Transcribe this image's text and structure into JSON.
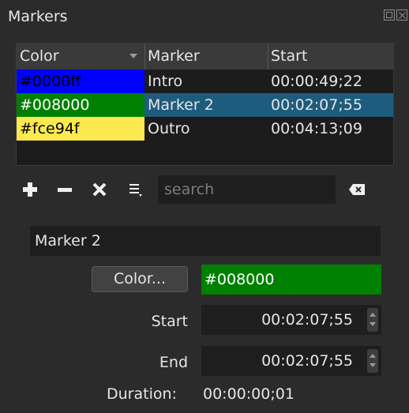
{
  "panel": {
    "title": "Markers",
    "float_icon": "float-window-icon",
    "close_icon": "close-window-icon"
  },
  "table": {
    "columns": [
      "Color",
      "Marker",
      "Start"
    ],
    "sort_column": "Color",
    "rows": [
      {
        "color": "#0000ff",
        "color_text": "#0000ff",
        "text_color": "#000000",
        "marker": "Intro",
        "start": "00:00:49;22",
        "selected": false
      },
      {
        "color": "#008000",
        "color_text": "#008000",
        "text_color": "#ffffff",
        "marker": "Marker 2",
        "start": "00:02:07;55",
        "selected": true
      },
      {
        "color": "#fce94f",
        "color_text": "#fce94f",
        "text_color": "#000000",
        "marker": "Outro",
        "start": "00:04:13;09",
        "selected": false
      }
    ],
    "selected_row_color": "#1e5c7d"
  },
  "toolbar": {
    "add_icon": "plus-icon",
    "remove_icon": "minus-icon",
    "clear_icon": "x-icon",
    "menu_icon": "list-menu-icon",
    "search_placeholder": "search",
    "search_value": "",
    "search_clear_icon": "backspace-icon"
  },
  "editor": {
    "name": "Marker 2",
    "color_button": "Color...",
    "color_value": "#008000",
    "start_label": "Start",
    "start_value": "00:02:07;55",
    "end_label": "End",
    "end_value": "00:02:07;55",
    "duration_label": "Duration:",
    "duration_value": "00:00:00;01"
  }
}
